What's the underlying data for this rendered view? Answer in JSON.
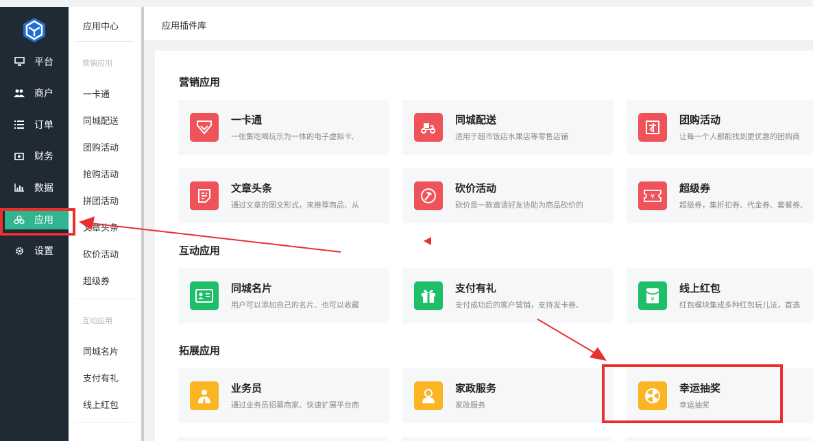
{
  "rail": {
    "items": [
      {
        "label": "平台",
        "icon": "monitor-icon"
      },
      {
        "label": "商户",
        "icon": "users-icon"
      },
      {
        "label": "订单",
        "icon": "list-icon"
      },
      {
        "label": "财务",
        "icon": "money-icon"
      },
      {
        "label": "数据",
        "icon": "bar-chart-icon"
      },
      {
        "label": "应用",
        "icon": "apps-icon",
        "active": true
      },
      {
        "label": "设置",
        "icon": "gear-icon"
      }
    ]
  },
  "submenu": {
    "title": "应用中心",
    "group1": "营销应用",
    "items1": [
      "一卡通",
      "同城配送",
      "团购活动",
      "抢购活动",
      "拼团活动",
      "文章头条",
      "砍价活动",
      "超级券"
    ],
    "group2": "互动应用",
    "items2": [
      "同城名片",
      "支付有礼",
      "线上红包"
    ]
  },
  "topbar": {
    "title": "应用插件库"
  },
  "sections": [
    {
      "title": "营销应用",
      "cards": [
        {
          "title": "一卡通",
          "desc": "一张集吃喝玩乐为一体的电子虚拟卡,",
          "icon": "diamond-icon",
          "color": "#f0525a"
        },
        {
          "title": "同城配送",
          "desc": "适用于超市饭店水果店等零售店铺",
          "icon": "scooter-icon",
          "color": "#f0525a"
        },
        {
          "title": "团购活动",
          "desc": "让每一个人都能找到更优惠的团购商",
          "icon": "group-buy-icon",
          "color": "#f0525a"
        },
        {
          "title": "文章头条",
          "desc": "通过文章的图文形式，来推荐商品、从",
          "icon": "article-icon",
          "color": "#f0525a"
        },
        {
          "title": "砍价活动",
          "desc": "砍价是一款邀请好友协助为商品砍价的",
          "icon": "axe-icon",
          "color": "#f0525a"
        },
        {
          "title": "超级券",
          "desc": "超级券，集折扣券、代金券、套餐券、",
          "icon": "coupon-icon",
          "color": "#f0525a"
        }
      ]
    },
    {
      "title": "互动应用",
      "cards": [
        {
          "title": "同城名片",
          "desc": "用户可以添加自己的名片、也可以收藏",
          "icon": "card-icon",
          "color": "#1fbf6a"
        },
        {
          "title": "支付有礼",
          "desc": "支付成功后的客户营销，支持发卡券、",
          "icon": "gift-icon",
          "color": "#1fbf6a"
        },
        {
          "title": "线上红包",
          "desc": "红包模块集成多种红包玩儿法，首选",
          "icon": "red-packet-icon",
          "color": "#1fbf6a"
        }
      ]
    },
    {
      "title": "拓展应用",
      "cards": [
        {
          "title": "业务员",
          "desc": "通过业务员招募商家、快速扩展平台商",
          "icon": "salesman-icon",
          "color": "#fbb422"
        },
        {
          "title": "家政服务",
          "desc": "家政服务",
          "icon": "housekeeping-icon",
          "color": "#fbb422"
        },
        {
          "title": "幸运抽奖",
          "desc": "幸运抽奖",
          "icon": "lottery-icon",
          "color": "#fbb422"
        }
      ]
    }
  ],
  "colors": {
    "rail_bg": "#1f2a35",
    "active": "#2fb58f",
    "annotation": "#e8302f"
  }
}
